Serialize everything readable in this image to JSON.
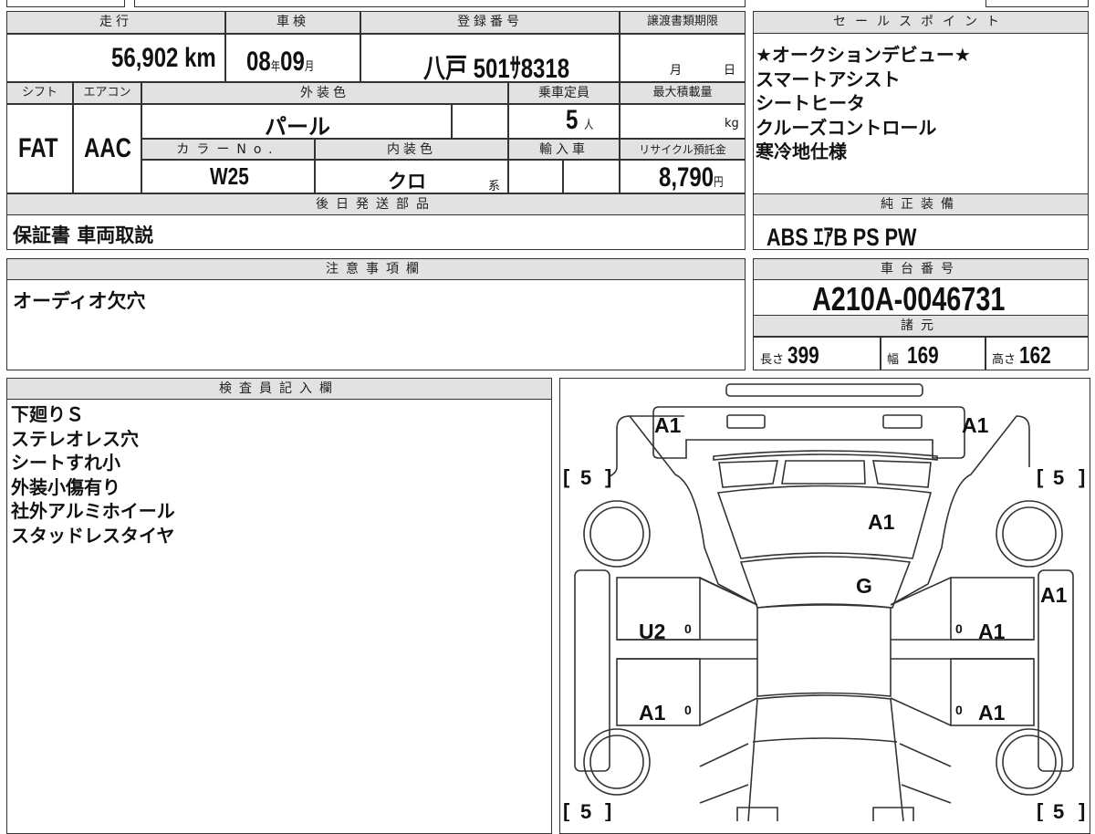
{
  "headers": {
    "mileage": "走行",
    "inspection": "車検",
    "registration": "登録番号",
    "transfer_deadline": "譲渡書類期限",
    "shift": "シフト",
    "aircon": "エアコン",
    "exterior_color": "外装色",
    "capacity": "乗車定員",
    "max_load": "最大積載量",
    "color_no": "カラーNo.",
    "interior_color": "内装色",
    "import": "輸入車",
    "recycle_fee": "リサイクル預託金",
    "later_parts": "後日発送部品",
    "sales_points": "セールスポイント",
    "equipment": "純正装備",
    "notes": "注意事項欄",
    "chassis_no": "車台番号",
    "specs": "諸元",
    "inspector": "検査員記入欄"
  },
  "values": {
    "mileage": "56,902",
    "mileage_unit": "km",
    "insp_year": "08",
    "year_unit": "年",
    "insp_month": "09",
    "month_unit": "月",
    "registration": "八戸 501ｻ8318",
    "deadline_month": "月",
    "deadline_day": "日",
    "shift": "FAT",
    "aircon": "AAC",
    "exterior_color": "パール",
    "capacity": "5",
    "capacity_unit": "人",
    "max_load_unit": "kg",
    "color_no": "W25",
    "interior_color": "クロ",
    "interior_suffix": "系",
    "recycle_fee": "8,790",
    "recycle_unit": "円",
    "later_parts": "保証書 車両取説",
    "equipment": "ABS ｴｱB PS PW",
    "notes": "オーディオ欠穴",
    "chassis_no": "A210A-0046731",
    "length_label": "長さ",
    "length": "399",
    "width_label": "幅",
    "width": "169",
    "height_label": "高さ",
    "height": "162"
  },
  "sales_points": [
    "★オークションデビュー★",
    "スマートアシスト",
    "シートヒータ",
    "クルーズコントロール",
    "寒冷地仕様"
  ],
  "inspector_notes": [
    "下廻りＳ",
    "ステレオレス穴",
    "シートすれ小",
    "外装小傷有り",
    "社外アルミホイール",
    "スタッドレスタイヤ"
  ],
  "diagram": {
    "marks": {
      "rear_left": "A1",
      "rear_right": "A1",
      "roof": "A1",
      "glass": "G",
      "right_rear_fender": "A1",
      "left_rear_door": "U2",
      "left_front_door": "A1",
      "right_rear_door": "A1",
      "right_front_door": "A1"
    },
    "zero": "0",
    "tire_rl": "5",
    "tire_rr": "5",
    "tire_fl": "5",
    "tire_fr": "5",
    "bracket_open": "[",
    "bracket_close": "]"
  }
}
